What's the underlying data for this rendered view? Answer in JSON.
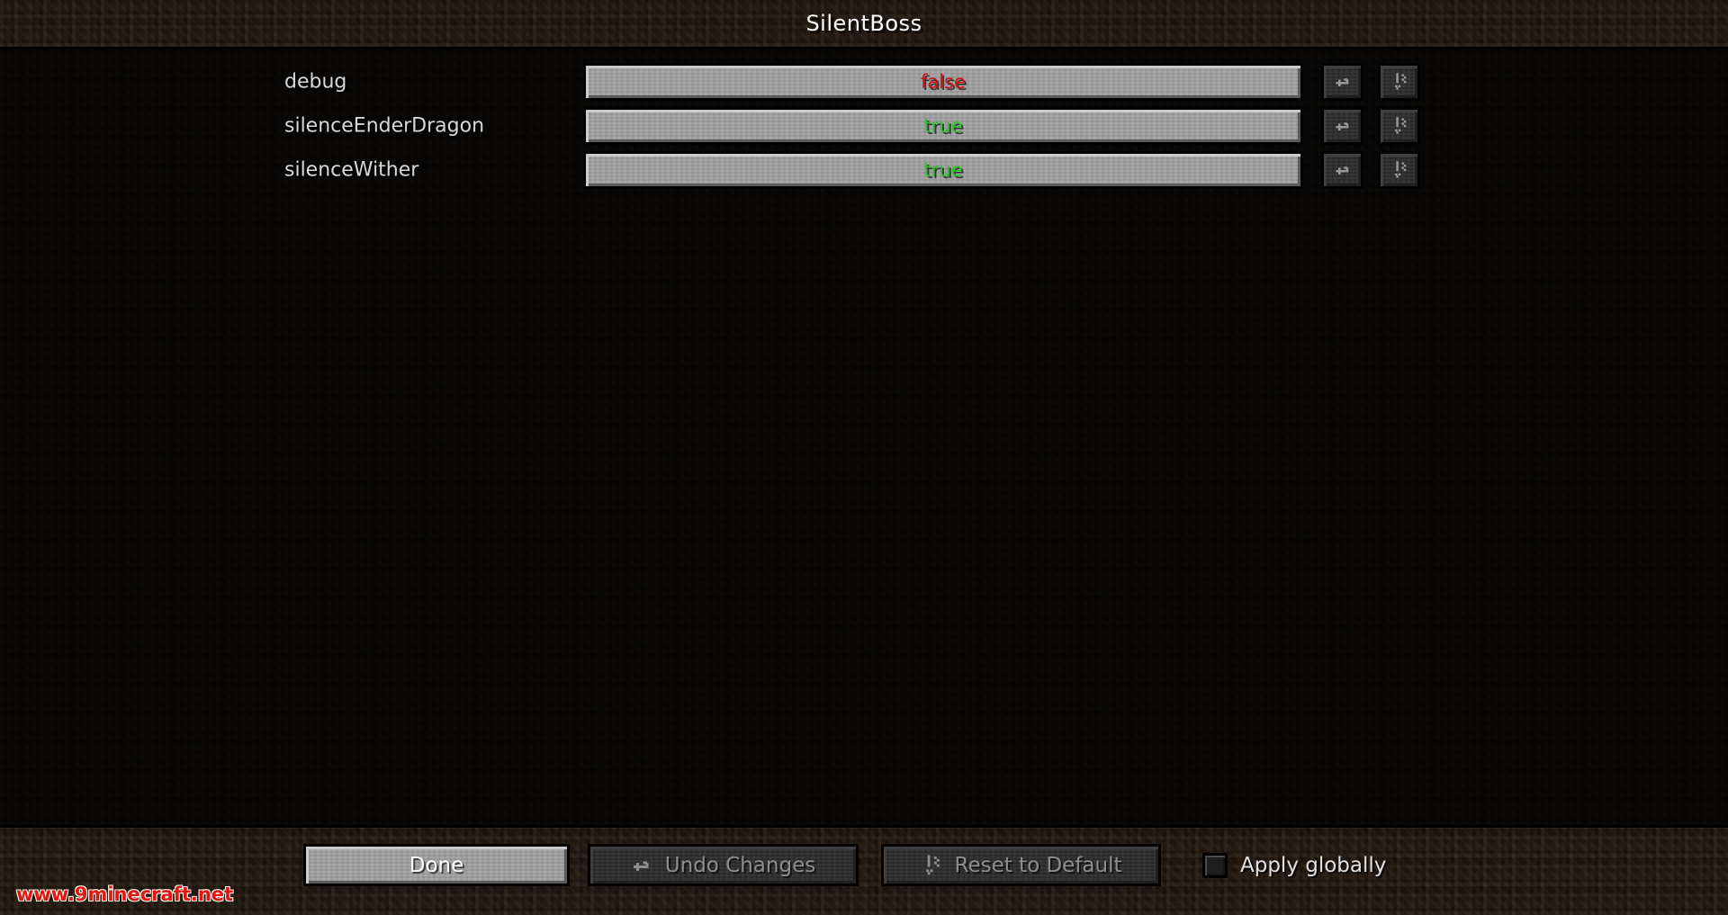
{
  "window": {
    "title": "SilentBoss"
  },
  "config_rows": [
    {
      "label": "debug",
      "value": "false",
      "value_state": "false",
      "undo_icon": "undo-arrow-icon",
      "reset_icon": "reset-to-default-icon"
    },
    {
      "label": "silenceEnderDragon",
      "value": "true",
      "value_state": "true",
      "undo_icon": "undo-arrow-icon",
      "reset_icon": "reset-to-default-icon"
    },
    {
      "label": "silenceWither",
      "value": "true",
      "value_state": "true",
      "undo_icon": "undo-arrow-icon",
      "reset_icon": "reset-to-default-icon"
    }
  ],
  "footer": {
    "done_label": "Done",
    "undo_changes_label": "Undo Changes",
    "reset_default_label": "Reset to Default",
    "apply_globally_label": "Apply globally",
    "apply_globally_checked": false,
    "undo_icon": "undo-arrow-icon",
    "reset_icon": "reset-to-default-icon"
  },
  "watermark": {
    "text": "www.9minecraft.net"
  },
  "colors": {
    "value_true": "#27c427",
    "value_false": "#cc1414",
    "title_text": "#ffffff",
    "label_text": "#d8d8d8",
    "watermark_red": "#e11616",
    "button_face": "#a0a0a0",
    "button_dark_face": "#2d2d2d",
    "dirt_background": "#3b2c1d"
  }
}
